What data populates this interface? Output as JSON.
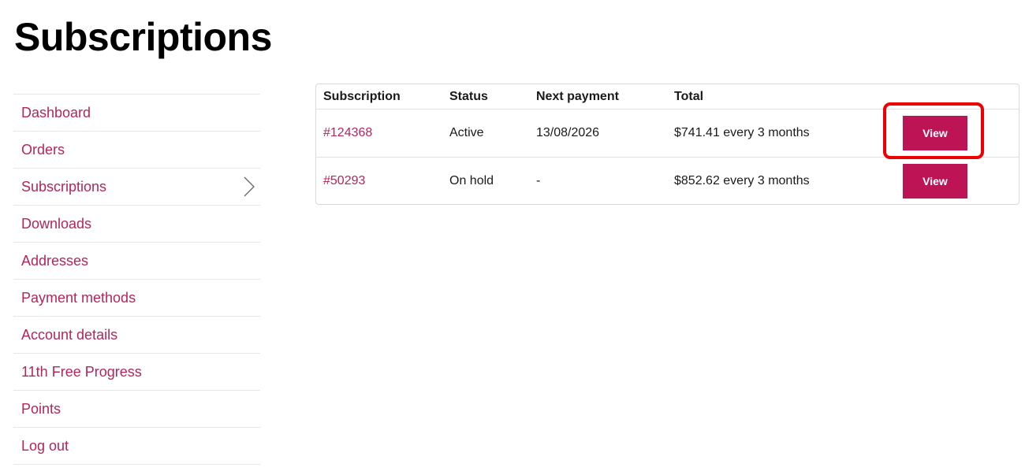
{
  "page": {
    "title": "Subscriptions"
  },
  "sidebar": {
    "items": [
      {
        "label": "Dashboard"
      },
      {
        "label": "Orders"
      },
      {
        "label": "Subscriptions",
        "active": true
      },
      {
        "label": "Downloads"
      },
      {
        "label": "Addresses"
      },
      {
        "label": "Payment methods"
      },
      {
        "label": "Account details"
      },
      {
        "label": "11th Free Progress"
      },
      {
        "label": "Points"
      },
      {
        "label": "Log out"
      }
    ],
    "active_indicator_icon": "chevron-right-icon"
  },
  "table": {
    "headers": {
      "subscription": "Subscription",
      "status": "Status",
      "next_payment": "Next payment",
      "total": "Total"
    },
    "rows": [
      {
        "id": "#124368",
        "status": "Active",
        "next_payment": "13/08/2026",
        "total": "$741.41 every 3 months",
        "action": "View"
      },
      {
        "id": "#50293",
        "status": "On hold",
        "next_payment": "-",
        "total": "$852.62 every 3 months",
        "action": "View"
      }
    ]
  },
  "colors": {
    "link": "#b4255a",
    "button": "#bc1454",
    "highlight": "#ee0000"
  }
}
